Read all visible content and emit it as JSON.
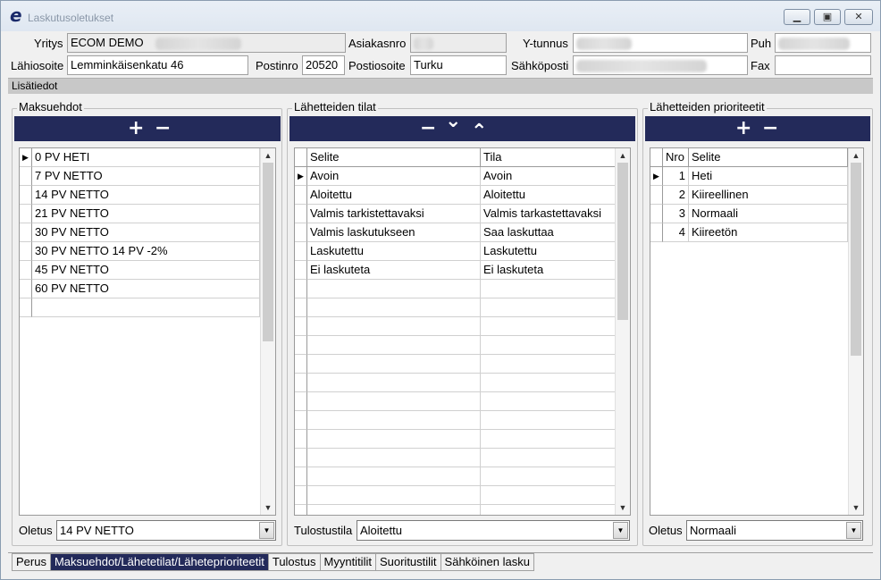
{
  "window": {
    "title": "Laskutusoletukset",
    "app_icon": "e"
  },
  "header": {
    "yritys_label": "Yritys",
    "yritys_value": "ECOM DEMO",
    "asiakasnro_label": "Asiakasnro",
    "ytunnus_label": "Y-tunnus",
    "puh_label": "Puh",
    "lahiosoite_label": "Lähiosoite",
    "lahiosoite_value": "Lemminkäisenkatu 46",
    "postinro_label": "Postinro",
    "postinro_value": "20520",
    "postiosoite_label": "Postiosoite",
    "postiosoite_value": "Turku",
    "sahkoposti_label": "Sähköposti",
    "fax_label": "Fax",
    "fax_value": ""
  },
  "section_title": "Lisätiedot",
  "maksuehdot": {
    "title": "Maksuehdot",
    "rows": [
      "0 PV HETI",
      "7 PV NETTO",
      "14 PV NETTO",
      "21 PV NETTO",
      "30 PV NETTO",
      "30 PV NETTO 14 PV -2%",
      "45 PV NETTO",
      "60 PV NETTO",
      ""
    ],
    "default_label": "Oletus",
    "default_value": "14 PV NETTO"
  },
  "tilat": {
    "title": "Lähetteiden tilat",
    "col_selite": "Selite",
    "col_tila": "Tila",
    "rows": [
      {
        "selite": "Avoin",
        "tila": "Avoin"
      },
      {
        "selite": "Aloitettu",
        "tila": "Aloitettu"
      },
      {
        "selite": "Valmis tarkistettavaksi",
        "tila": "Valmis tarkastettavaksi"
      },
      {
        "selite": "Valmis laskutukseen",
        "tila": "Saa laskuttaa"
      },
      {
        "selite": "Laskutettu",
        "tila": "Laskutettu"
      },
      {
        "selite": "Ei laskuteta",
        "tila": "Ei laskuteta"
      }
    ],
    "default_label": "Tulostustila",
    "default_value": "Aloitettu"
  },
  "prioriteetit": {
    "title": "Lähetteiden prioriteetit",
    "col_nro": "Nro",
    "col_selite": "Selite",
    "rows": [
      {
        "nro": "1",
        "selite": "Heti"
      },
      {
        "nro": "2",
        "selite": "Kiireellinen"
      },
      {
        "nro": "3",
        "selite": "Normaali"
      },
      {
        "nro": "4",
        "selite": "Kiireetön"
      }
    ],
    "default_label": "Oletus",
    "default_value": "Normaali"
  },
  "tabs": [
    "Perus",
    "Maksuehdot/Lähetetilat/Läheteprioriteetit",
    "Tulostus",
    "Myyntitilit",
    "Suoritustilit",
    "Sähköinen lasku"
  ],
  "active_tab": 1,
  "icons": {
    "add": "+",
    "remove": "−",
    "down": "⌄",
    "up": "⌃"
  }
}
